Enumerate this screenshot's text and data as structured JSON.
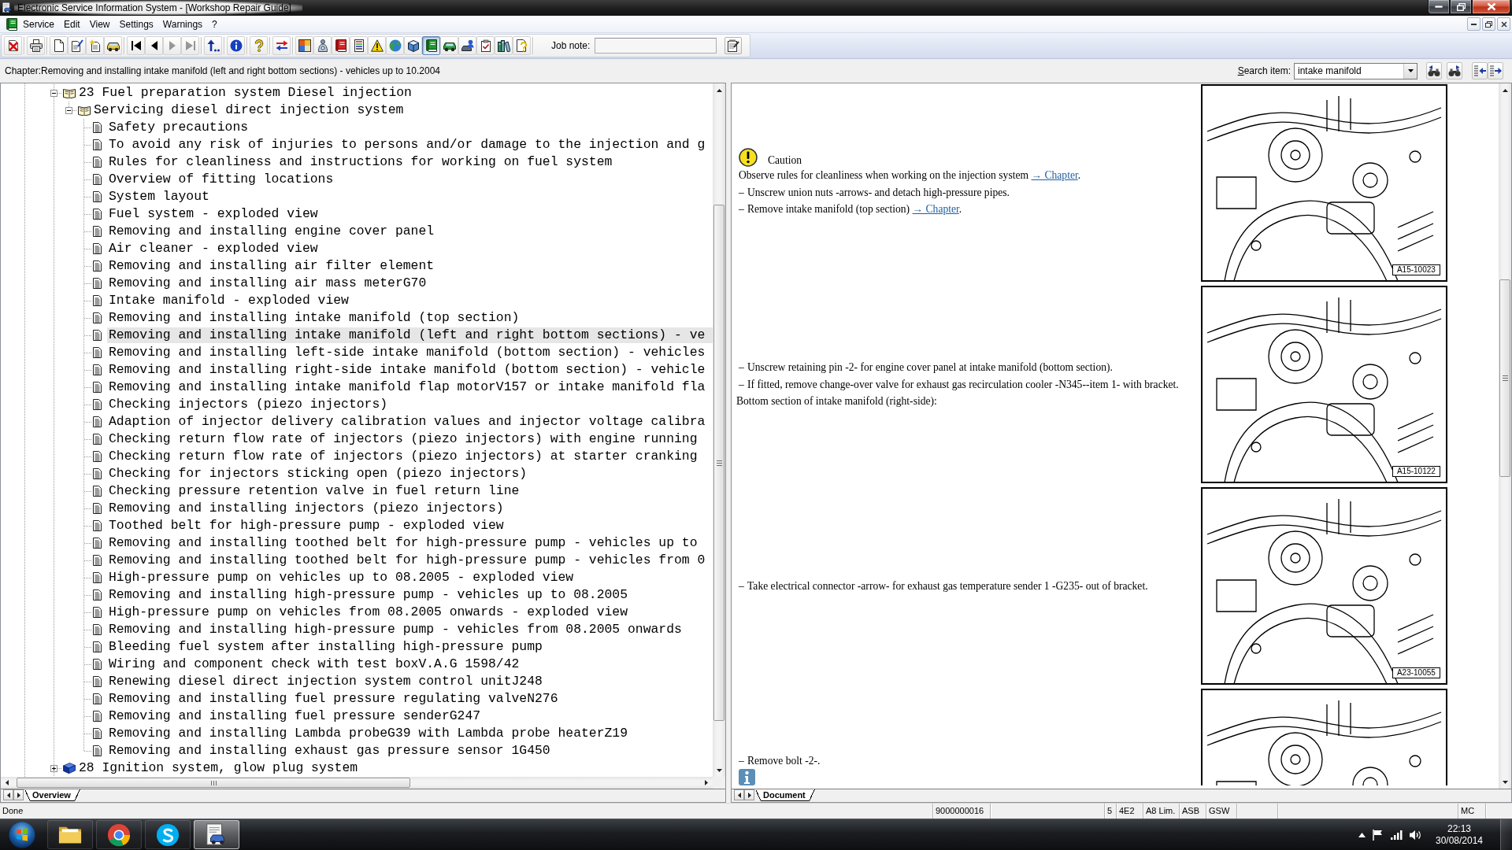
{
  "window": {
    "title": "Electronic Service Information System - [Workshop Repair Guide]"
  },
  "menu": [
    "Service",
    "Edit",
    "View",
    "Settings",
    "Warnings",
    "?"
  ],
  "toolbar": {
    "groups": [
      [
        {
          "kind": "exit",
          "disabled": false,
          "pressed": false
        }
      ],
      [
        {
          "kind": "print",
          "disabled": false,
          "pressed": false
        }
      ],
      [
        {
          "kind": "new",
          "disabled": false,
          "pressed": false
        },
        {
          "kind": "edit",
          "disabled": false,
          "pressed": false
        },
        {
          "kind": "create",
          "disabled": false,
          "pressed": false
        },
        {
          "kind": "vehicle",
          "disabled": false,
          "pressed": false
        }
      ],
      [
        {
          "kind": "first",
          "disabled": false,
          "pressed": false
        },
        {
          "kind": "previous",
          "disabled": false,
          "pressed": false
        },
        {
          "kind": "next",
          "disabled": true,
          "pressed": false
        },
        {
          "kind": "last",
          "disabled": true,
          "pressed": false
        }
      ],
      [
        {
          "kind": "up",
          "disabled": false,
          "pressed": false
        }
      ],
      [
        {
          "kind": "info",
          "disabled": false,
          "pressed": false
        }
      ],
      [
        {
          "kind": "help",
          "disabled": false,
          "pressed": false
        }
      ],
      [
        {
          "kind": "swap",
          "disabled": false,
          "pressed": false
        }
      ],
      [
        {
          "kind": "modules",
          "disabled": false,
          "pressed": false
        },
        {
          "kind": "diagnostics",
          "disabled": false,
          "pressed": false
        },
        {
          "kind": "manual",
          "disabled": false,
          "pressed": false
        },
        {
          "kind": "list",
          "disabled": false,
          "pressed": false
        },
        {
          "kind": "warnings",
          "disabled": false,
          "pressed": false
        },
        {
          "kind": "web",
          "disabled": false,
          "pressed": false
        },
        {
          "kind": "package",
          "disabled": false,
          "pressed": false
        },
        {
          "kind": "guide",
          "disabled": false,
          "pressed": true
        },
        {
          "kind": "car",
          "disabled": false,
          "pressed": false
        },
        {
          "kind": "customer",
          "disabled": false,
          "pressed": false
        },
        {
          "kind": "checklist",
          "disabled": false,
          "pressed": false
        },
        {
          "kind": "library",
          "disabled": false,
          "pressed": false
        },
        {
          "kind": "query",
          "disabled": false,
          "pressed": false
        }
      ]
    ],
    "job_note": {
      "label": "Job note:"
    }
  },
  "chapter_bar": {
    "text": "Chapter:Removing and installing intake manifold (left and right bottom sections) - vehicles up to 10.2004",
    "search": {
      "label": "Search item:",
      "value": "intake manifold"
    }
  },
  "tree": {
    "items": [
      {
        "kind": "chapter",
        "label": "23 Fuel preparation system Diesel injection",
        "expanded": true,
        "selected": false,
        "children": [
          {
            "kind": "chapter",
            "label": "Servicing diesel direct injection system",
            "expanded": true,
            "selected": false,
            "children": [
              {
                "kind": "topic",
                "label": "Safety precautions",
                "selected": false
              },
              {
                "kind": "topic",
                "label": "To avoid any risk of injuries to persons and/or damage to the injection and g",
                "selected": false
              },
              {
                "kind": "topic",
                "label": "Rules for cleanliness and instructions for working on fuel system",
                "selected": false
              },
              {
                "kind": "topic",
                "label": "Overview of fitting locations",
                "selected": false
              },
              {
                "kind": "topic",
                "label": "System layout",
                "selected": false
              },
              {
                "kind": "topic",
                "label": "Fuel system - exploded view",
                "selected": false
              },
              {
                "kind": "topic",
                "label": "Removing and installing engine cover panel",
                "selected": false
              },
              {
                "kind": "topic",
                "label": "Air cleaner - exploded view",
                "selected": false
              },
              {
                "kind": "topic",
                "label": "Removing and installing air filter element",
                "selected": false
              },
              {
                "kind": "topic",
                "label": "Removing and installing air mass meterG70",
                "selected": false
              },
              {
                "kind": "topic",
                "label": "Intake manifold - exploded view",
                "selected": false
              },
              {
                "kind": "topic",
                "label": "Removing and installing intake manifold (top section)",
                "selected": false
              },
              {
                "kind": "topic",
                "label": "Removing and installing intake manifold (left and right bottom sections) - ve",
                "selected": true
              },
              {
                "kind": "topic",
                "label": "Removing and installing left-side intake manifold (bottom section) - vehicles",
                "selected": false
              },
              {
                "kind": "topic",
                "label": "Removing and installing right-side intake manifold (bottom section) - vehicle",
                "selected": false
              },
              {
                "kind": "topic",
                "label": "Removing and installing intake manifold flap motorV157 or intake manifold fla",
                "selected": false
              },
              {
                "kind": "topic",
                "label": "Checking injectors (piezo injectors)",
                "selected": false
              },
              {
                "kind": "topic",
                "label": "Adaption of injector delivery calibration values and injector voltage calibra",
                "selected": false
              },
              {
                "kind": "topic",
                "label": "Checking return flow rate of injectors (piezo injectors) with engine running",
                "selected": false
              },
              {
                "kind": "topic",
                "label": "Checking return flow rate of injectors (piezo injectors) at starter cranking",
                "selected": false
              },
              {
                "kind": "topic",
                "label": "Checking for injectors sticking open (piezo injectors)",
                "selected": false
              },
              {
                "kind": "topic",
                "label": "Checking pressure retention valve in fuel return line",
                "selected": false
              },
              {
                "kind": "topic",
                "label": "Removing and installing injectors (piezo injectors)",
                "selected": false
              },
              {
                "kind": "topic",
                "label": "Toothed belt for high-pressure pump - exploded view",
                "selected": false
              },
              {
                "kind": "topic",
                "label": "Removing and installing toothed belt for high-pressure pump - vehicles up to",
                "selected": false
              },
              {
                "kind": "topic",
                "label": "Removing and installing toothed belt for high-pressure pump - vehicles from 0",
                "selected": false
              },
              {
                "kind": "topic",
                "label": "High-pressure pump on vehicles up to 08.2005 - exploded view",
                "selected": false
              },
              {
                "kind": "topic",
                "label": "Removing and installing high-pressure pump - vehicles up to 08.2005",
                "selected": false
              },
              {
                "kind": "topic",
                "label": "High-pressure pump on vehicles from 08.2005 onwards - exploded view",
                "selected": false
              },
              {
                "kind": "topic",
                "label": "Removing and installing high-pressure pump - vehicles from 08.2005 onwards",
                "selected": false
              },
              {
                "kind": "topic",
                "label": "Bleeding fuel system after installing high-pressure pump",
                "selected": false
              },
              {
                "kind": "topic",
                "label": "Wiring and component check with test boxV.A.G 1598/42",
                "selected": false
              },
              {
                "kind": "topic",
                "label": "Renewing diesel direct injection system control unitJ248",
                "selected": false
              },
              {
                "kind": "topic",
                "label": "Removing and installing fuel pressure regulating valveN276",
                "selected": false
              },
              {
                "kind": "topic",
                "label": "Removing and installing fuel pressure senderG247",
                "selected": false
              },
              {
                "kind": "topic",
                "label": "Removing and installing Lambda probeG39 with Lambda probe heaterZ19",
                "selected": false
              },
              {
                "kind": "topic",
                "label": "Removing and installing exhaust gas pressure sensor 1G450",
                "selected": false
              }
            ]
          }
        ]
      },
      {
        "kind": "chapter",
        "label": "28 Ignition system, glow plug system",
        "expanded": false,
        "selected": false
      }
    ],
    "tabs": [
      {
        "label": "Overview",
        "selected": true
      }
    ]
  },
  "document": {
    "rows": [
      {
        "blocks": [
          {
            "kind": "caution",
            "label": "Caution",
            "text": "Observe rules for cleanliness when working on the injection system",
            "link": "→ Chapter",
            "tail": "."
          },
          {
            "kind": "step",
            "marker": "–",
            "text": "Unscrew union nuts -arrows- and detach high-pressure pipes."
          },
          {
            "kind": "step",
            "marker": "–",
            "text": "Remove intake manifold (top section)",
            "link": "→ Chapter",
            "tail": "."
          }
        ],
        "figure": {
          "code": "A15-10023",
          "cropped": false
        }
      },
      {
        "blocks": [
          {
            "kind": "step",
            "marker": "–",
            "text": "Unscrew retaining pin -2- for engine cover panel at intake manifold (bottom section)."
          },
          {
            "kind": "step",
            "marker": "–",
            "text": "If fitted, remove change-over valve for exhaust gas recirculation cooler -N345--item 1- with bracket."
          },
          {
            "kind": "paragraph",
            "text": "Bottom section of intake manifold (right-side):"
          }
        ],
        "figure": {
          "code": "A15-10122",
          "cropped": false
        }
      },
      {
        "blocks": [
          {
            "kind": "step",
            "marker": "–",
            "text": "Take electrical connector -arrow- for exhaust gas temperature sender 1 -G235- out of bracket."
          }
        ],
        "figure": {
          "code": "A23-10055",
          "cropped": false
        }
      },
      {
        "blocks": [
          {
            "kind": "step",
            "marker": "–",
            "text": "Remove bolt -2-."
          },
          {
            "kind": "note"
          }
        ],
        "figure": {
          "cropped": true
        }
      }
    ],
    "tabs": [
      {
        "label": "Document",
        "selected": true
      }
    ]
  },
  "status_bar": {
    "message": "Done",
    "panes": [
      {
        "kind": "text",
        "text": "9000000016"
      },
      {
        "kind": "blank"
      },
      {
        "kind": "text",
        "text": "5"
      },
      {
        "kind": "text",
        "text": "4E2"
      },
      {
        "kind": "text",
        "text": "A8 Lim."
      },
      {
        "kind": "text",
        "text": "ASB"
      },
      {
        "kind": "text",
        "text": "GSW"
      },
      {
        "kind": "blank"
      },
      {
        "kind": "blank"
      },
      {
        "kind": "text",
        "text": "MC"
      }
    ]
  },
  "taskbar": {
    "apps": [
      {
        "kind": "folder",
        "selected": false
      },
      {
        "kind": "browser",
        "selected": false
      },
      {
        "kind": "chat",
        "selected": false
      },
      {
        "kind": "manual",
        "selected": true
      }
    ],
    "clock": {
      "time": "22:13",
      "date": "30/08/2014"
    }
  }
}
